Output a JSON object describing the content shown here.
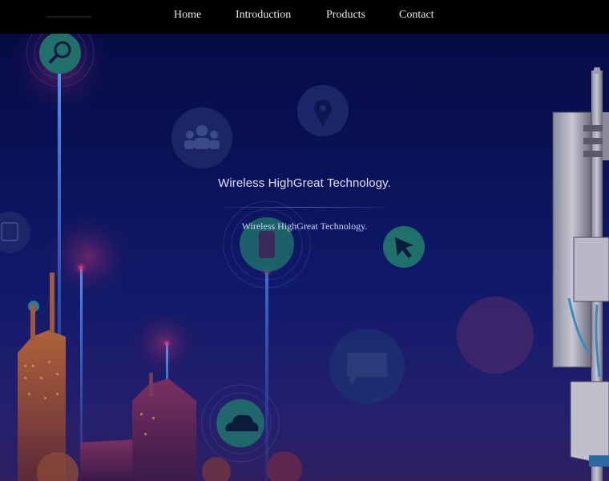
{
  "nav": {
    "items": [
      {
        "label": "Home"
      },
      {
        "label": "Introduction"
      },
      {
        "label": "Products"
      },
      {
        "label": "Contact"
      }
    ]
  },
  "hero": {
    "title": "Wireless HighGreat Technology.",
    "subtitle": "Wireless HighGreat Technology.",
    "icons": [
      "search-icon",
      "people-icon",
      "location-pin-icon",
      "bus-icon",
      "smartphone-icon",
      "cursor-arrow-icon",
      "chat-bubble-icon",
      "cloud-icon"
    ]
  },
  "colors": {
    "nav_background": "#000000",
    "hero_top": "#050a3e",
    "hero_bottom": "#2e2060",
    "icon_teal": "#1f6f6a",
    "glow_pink": "#ff3d7f"
  }
}
